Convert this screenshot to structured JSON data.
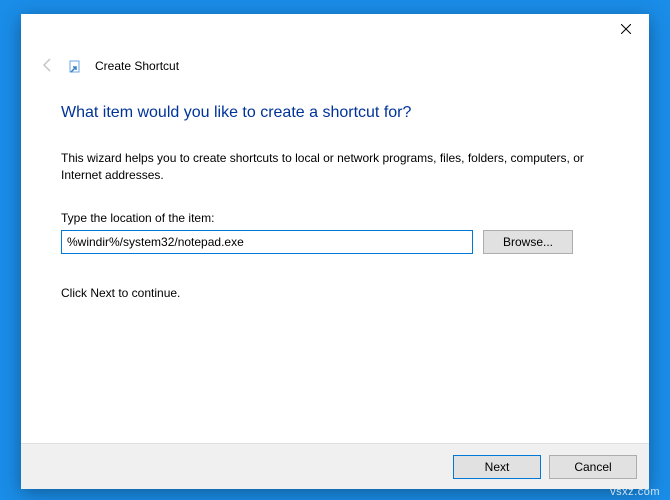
{
  "dialog": {
    "breadcrumb": "Create Shortcut",
    "heading": "What item would you like to create a shortcut for?",
    "description": "This wizard helps you to create shortcuts to local or network programs, files, folders, computers, or Internet addresses.",
    "location_label": "Type the location of the item:",
    "location_value": "%windir%/system32/notepad.exe",
    "browse_label": "Browse...",
    "continue_text": "Click Next to continue.",
    "next_label": "Next",
    "cancel_label": "Cancel"
  },
  "watermark": "vsxz.com"
}
